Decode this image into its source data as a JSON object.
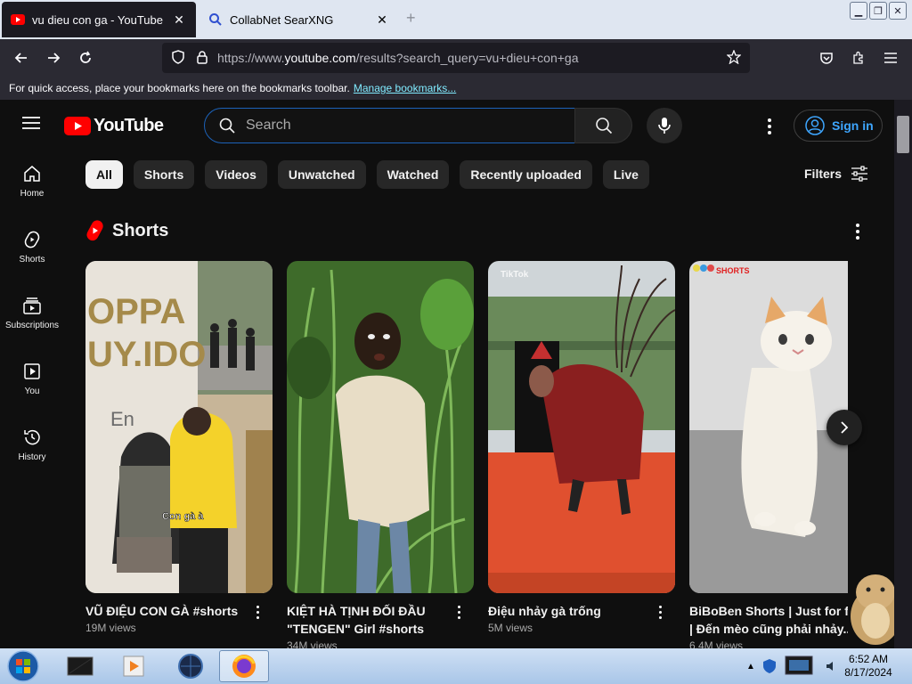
{
  "browser": {
    "tabs": [
      {
        "title": "vu dieu con ga - YouTube",
        "active": true
      },
      {
        "title": "CollabNet SearXNG",
        "active": false
      }
    ],
    "new_tab": "+",
    "url_prefix": "https://www.",
    "url_domain": "youtube.com",
    "url_path": "/results?search_query=vu+dieu+con+ga",
    "bookmarks_text": "For quick access, place your bookmarks here on the bookmarks toolbar.",
    "bookmarks_link": "Manage bookmarks..."
  },
  "youtube": {
    "logo_text": "YouTube",
    "search_placeholder": "Search",
    "signin_label": "Sign in",
    "sidebar": [
      {
        "label": "Home",
        "icon": "home-icon"
      },
      {
        "label": "Shorts",
        "icon": "shorts-icon"
      },
      {
        "label": "Subscriptions",
        "icon": "subscriptions-icon"
      },
      {
        "label": "You",
        "icon": "you-icon"
      },
      {
        "label": "History",
        "icon": "history-icon"
      }
    ],
    "chips": [
      "All",
      "Shorts",
      "Videos",
      "Unwatched",
      "Watched",
      "Recently uploaded",
      "Live"
    ],
    "filters_label": "Filters",
    "shorts_heading": "Shorts",
    "shorts": [
      {
        "title": "VŨ ĐIỆU CON GÀ #shorts",
        "views": "19M views",
        "caption": "Con gà à"
      },
      {
        "title": "KIỆT HÀ TỊNH ĐỐI ĐẦU \"TENGEN\" Girl #shorts",
        "views": "34M views"
      },
      {
        "title": "Điệu nhảy gà trống",
        "views": "5M views",
        "caption": "TikTok"
      },
      {
        "title": "BiBoBen Shorts | Just for fun | Đến mèo cũng phải nhảy...",
        "views": "6.4M views",
        "caption": "SHORTS"
      }
    ]
  },
  "taskbar": {
    "time": "6:52 AM",
    "date": "8/17/2024"
  },
  "colors": {
    "yt_red": "#ff0000",
    "accent_blue": "#3ea6ff",
    "bg": "#0f0f0f"
  }
}
